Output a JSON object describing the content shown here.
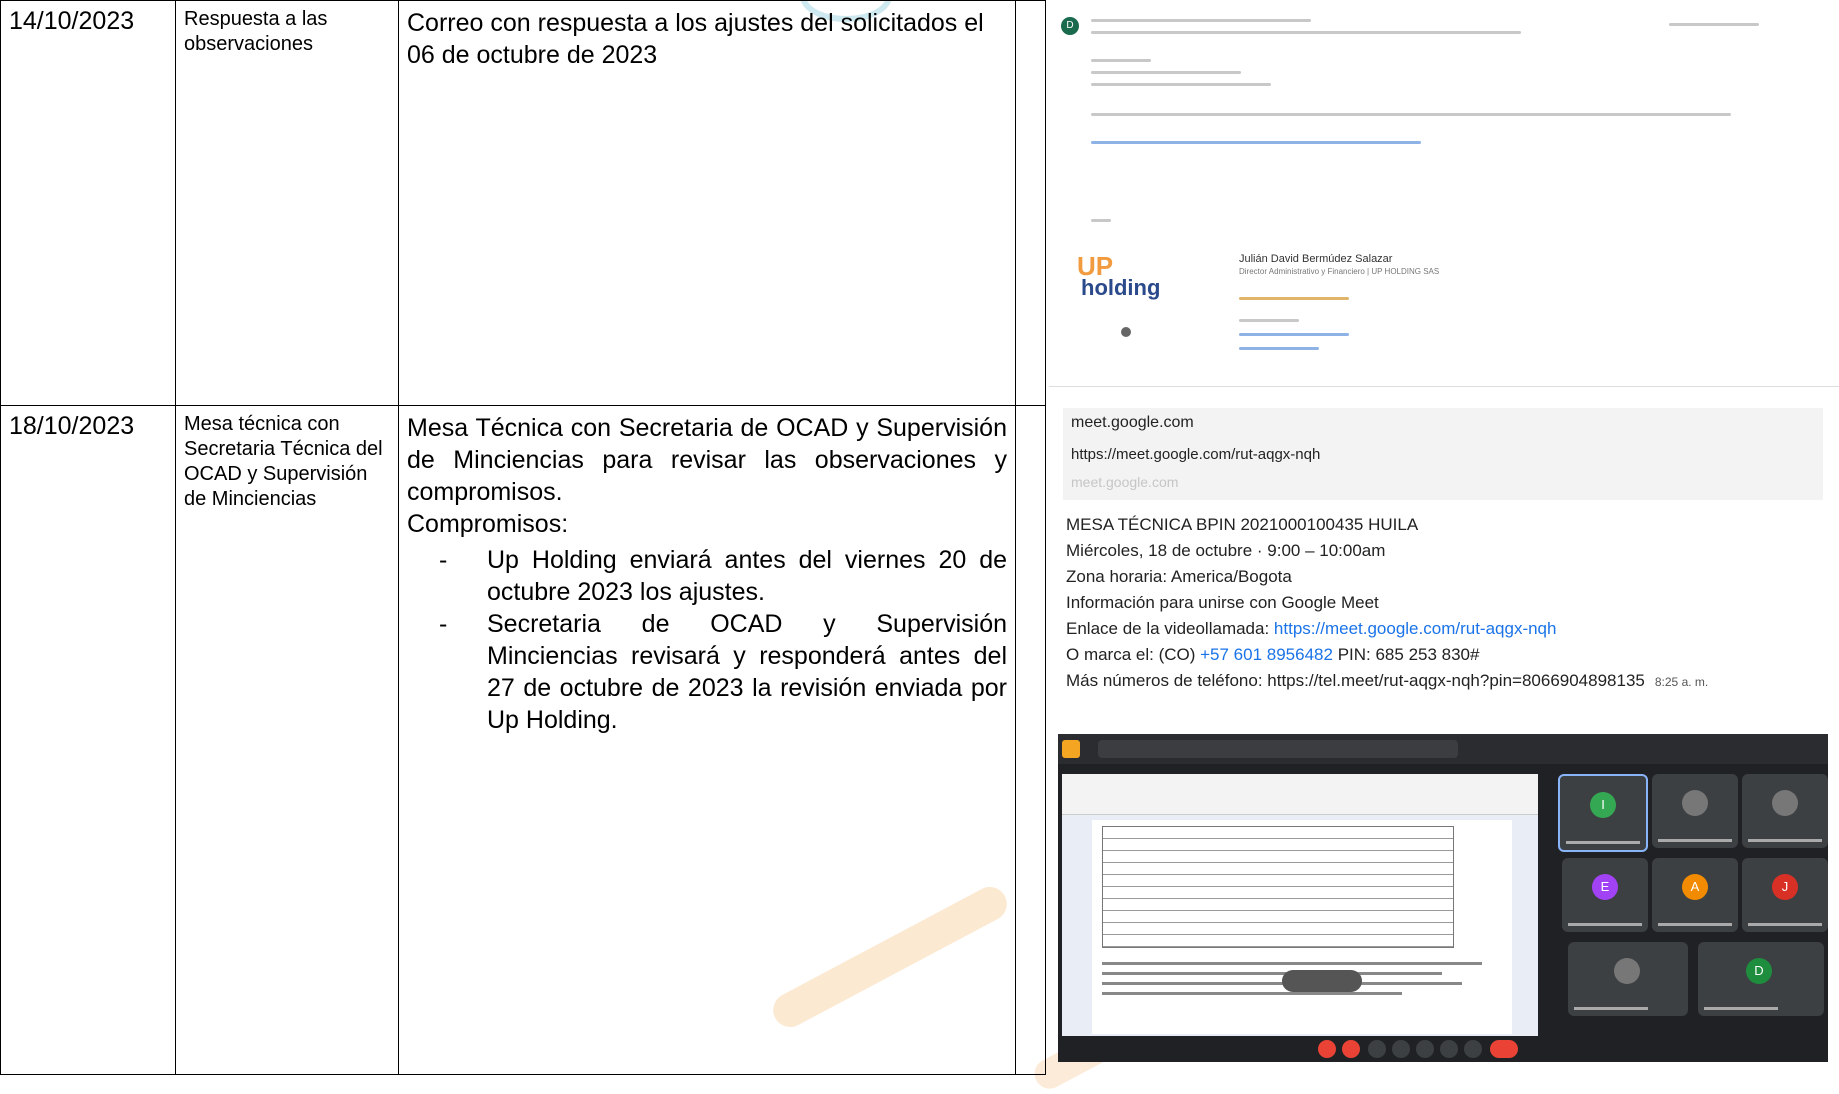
{
  "rows": [
    {
      "date": "14/10/2023",
      "activity": "Respuesta a las observaciones",
      "description": "Correo con respuesta a los ajustes del solicitados el 06 de octubre de 2023"
    },
    {
      "date": "18/10/2023",
      "activity": "Mesa técnica con Secretaria Técnica del OCAD y Supervisión de Minciencias",
      "description_intro": "Mesa Técnica con Secretaria de OCAD y Supervisión de Minciencias para revisar las observaciones y compromisos.",
      "commitments_label": "Compromisos:",
      "commitments": [
        "Up Holding enviará antes del viernes 20 de octubre 2023 los ajustes.",
        "Secretaria de OCAD y Supervisión Minciencias revisará y responderá antes del 27 de octubre de 2023 la revisión enviada por Up Holding."
      ],
      "bullet": "-"
    }
  ],
  "email_evidence": {
    "avatar_letter": "D",
    "signature_name": "Julián David Bermúdez Salazar",
    "signature_role": "Director Administrativo y Financiero | UP HOLDING SAS",
    "logo_up": "UP",
    "logo_holding": "holding"
  },
  "meet_evidence": {
    "card_domain": "meet.google.com",
    "card_url": "https://meet.google.com/rut-aqgx-nqh",
    "card_domain_faded": "meet.google.com",
    "title": "MESA TÉCNICA BPIN 2021000100435 HUILA",
    "datetime": "Miércoles, 18 de octubre · 9:00 – 10:00am",
    "timezone": "Zona horaria: America/Bogota",
    "join_info": "Información para unirse con Google Meet",
    "video_label": "Enlace de la videollamada: ",
    "video_link": "https://meet.google.com/rut-aqgx-nqh",
    "dial_label": "O marca el: (CO) ",
    "dial_number": "+57 601 8956482",
    "dial_pin": " PIN: 685 253 830#",
    "more_numbers": "Más números de teléfono: https://tel.meet/rut-aqgx-nqh?pin=8066904898135",
    "time_sent": "8:25 a. m."
  },
  "call_tiles": [
    {
      "letter": "I",
      "color": "#34a853"
    },
    {
      "letter": "",
      "color": "#777777"
    },
    {
      "letter": "",
      "color": "#777777"
    },
    {
      "letter": "E",
      "color": "#a142f4"
    },
    {
      "letter": "A",
      "color": "#f28b00"
    },
    {
      "letter": "J",
      "color": "#d93025"
    },
    {
      "letter": "",
      "color": "#777777"
    },
    {
      "letter": "D",
      "color": "#1e8e3e"
    }
  ],
  "colors": {
    "accent_orange": "#f5a623",
    "link_blue": "#1a73e8"
  }
}
